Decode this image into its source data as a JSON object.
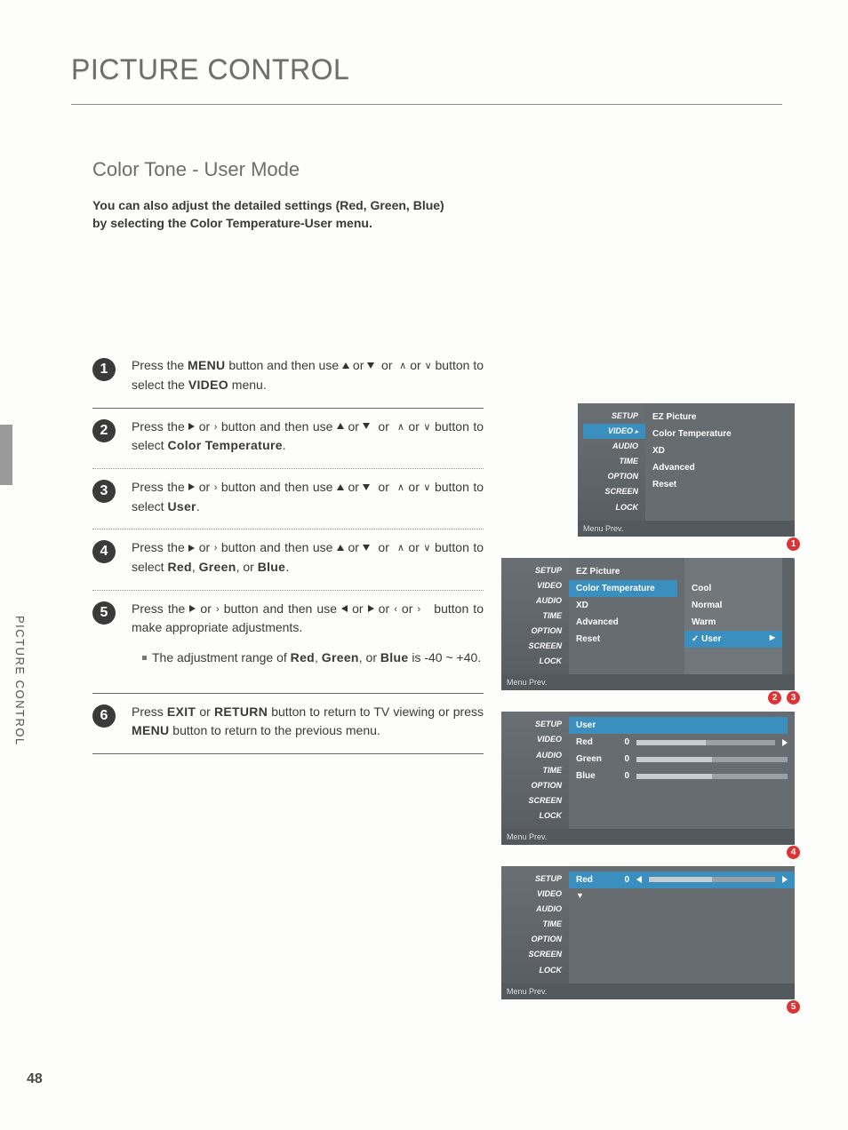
{
  "page": {
    "title": "PICTURE CONTROL",
    "subtitle": "Color Tone - User Mode",
    "side_label": "PICTURE CONTROL",
    "page_number": "48",
    "intro_line1": "You can also adjust the detailed settings (Red, Green, Blue)",
    "intro_line2_pre": "by selecting the ",
    "intro_line2_bold": "Color Temperature-User",
    "intro_line2_post": " menu."
  },
  "steps": {
    "s1_pre": "Press the ",
    "s1_menu": "MENU",
    "s1_mid": " button and then use ",
    "s1_end_pre": " button to select the ",
    "s1_video": "VIDEO",
    "s1_end_post": " menu.",
    "s2_pre": "Press the ",
    "s2_mid": " button and then use ",
    "s2_end_pre": " button to select ",
    "s2_target": "Color Temperature",
    "s2_end_post": ".",
    "s3_pre": "Press the ",
    "s3_mid": " button and then use ",
    "s3_end_pre": " button to select ",
    "s3_target": "User",
    "s3_end_post": ".",
    "s4_pre": "Press the ",
    "s4_mid": " button and then use ",
    "s4_end_pre": " button to select ",
    "s4_red": "Red",
    "s4_green": "Green",
    "s4_blue": "Blue",
    "s4_end_post": ".",
    "s5_pre": "Press the ",
    "s5_mid": " button and then use ",
    "s5_end": " button to make appropriate adjustments.",
    "s5_note_pre": "The adjustment range of ",
    "s5_note_post": " is -40 ~ +40.",
    "s6_pre": "Press ",
    "s6_exit": "EXIT",
    "s6_or": " or ",
    "s6_return": "RETURN",
    "s6_mid": " button to return to TV viewing or press ",
    "s6_menu": "MENU",
    "s6_end": " button to return to the previous menu.",
    "or_word": " or ",
    "comma_or": ", or "
  },
  "osd": {
    "side_items": [
      "SETUP",
      "VIDEO",
      "AUDIO",
      "TIME",
      "OPTION",
      "SCREEN",
      "LOCK"
    ],
    "foot": "Menu Prev.",
    "panel1": {
      "items": [
        "EZ Picture",
        "Color Temperature",
        "XD",
        "Advanced",
        "Reset"
      ],
      "badge": [
        "1"
      ]
    },
    "panel2": {
      "items": [
        "EZ Picture",
        "Color Temperature",
        "XD",
        "Advanced",
        "Reset"
      ],
      "highlight": "Color Temperature",
      "sub": [
        "Cool",
        "Normal",
        "Warm",
        "User"
      ],
      "sub_highlight": "User",
      "check": "✓",
      "arrow": "▶",
      "badge": [
        "2",
        "3"
      ]
    },
    "panel3": {
      "header": "User",
      "rows": [
        {
          "label": "Red",
          "value": "0"
        },
        {
          "label": "Green",
          "value": "0"
        },
        {
          "label": "Blue",
          "value": "0"
        }
      ],
      "badge": [
        "4"
      ]
    },
    "panel4": {
      "row": {
        "label": "Red",
        "value": "0"
      },
      "down": "▼",
      "badge": [
        "5"
      ]
    }
  }
}
